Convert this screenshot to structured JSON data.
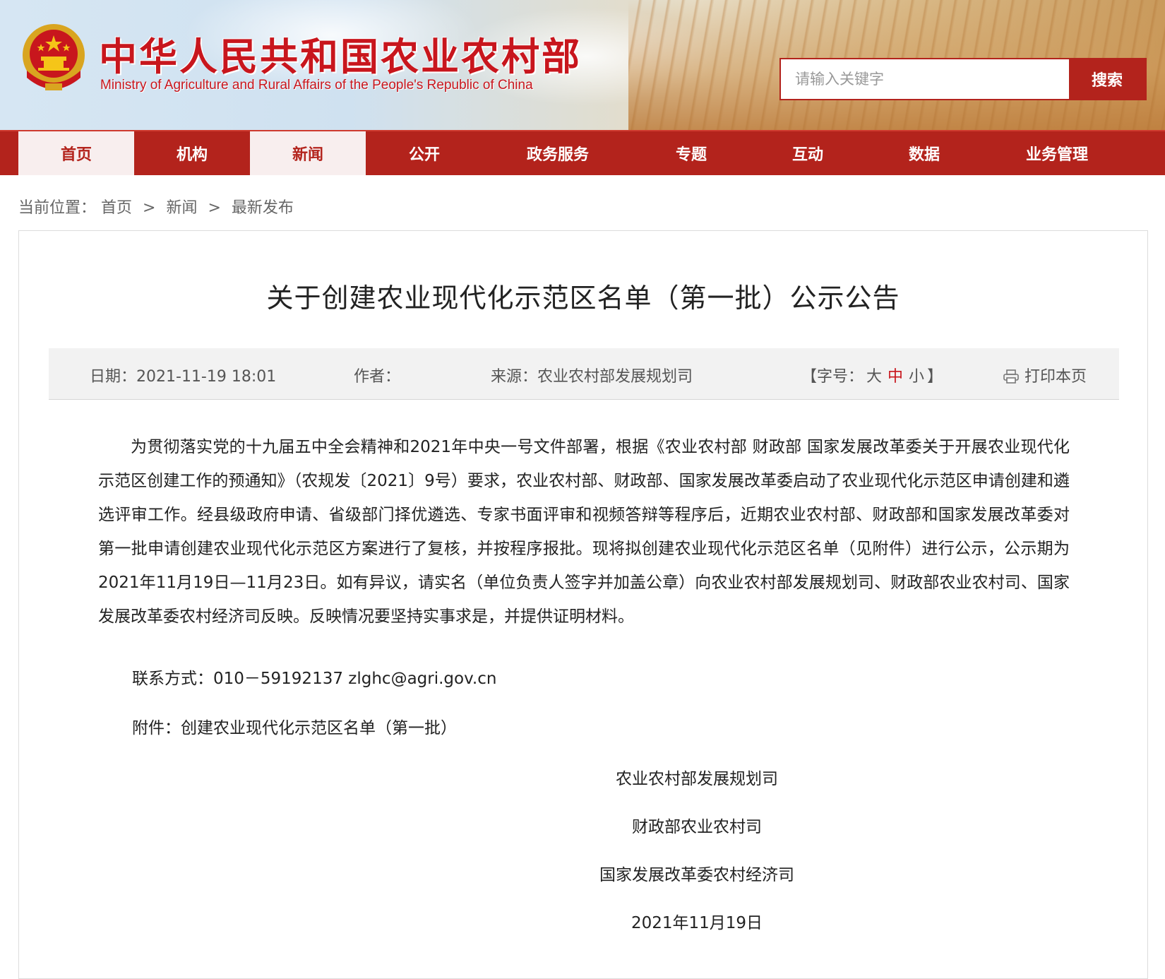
{
  "header": {
    "site_title": "中华人民共和国农业农村部",
    "site_subtitle": "Ministry of Agriculture and Rural Affairs of the People's Republic of China",
    "emblem_icon": "national-emblem-icon",
    "search": {
      "placeholder": "请输入关键字",
      "button_label": "搜索"
    }
  },
  "nav": {
    "items": [
      {
        "label": "首页",
        "active": true
      },
      {
        "label": "机构",
        "active": false
      },
      {
        "label": "新闻",
        "active": true
      },
      {
        "label": "公开",
        "active": false
      },
      {
        "label": "政务服务",
        "active": false
      },
      {
        "label": "专题",
        "active": false
      },
      {
        "label": "互动",
        "active": false
      },
      {
        "label": "数据",
        "active": false
      },
      {
        "label": "业务管理",
        "active": false
      }
    ]
  },
  "breadcrumb": {
    "prefix": "当前位置：",
    "items": [
      "首页",
      "新闻",
      "最新发布"
    ],
    "separator": ">"
  },
  "article": {
    "title": "关于创建农业现代化示范区名单（第一批）公示公告",
    "meta": {
      "date_label": "日期：",
      "date_value": "2021-11-19 18:01",
      "author_label": "作者：",
      "author_value": "",
      "source_label": "来源：",
      "source_value": "农业农村部发展规划司",
      "fontsize_open": "【字号：",
      "fontsize_large": "大",
      "fontsize_medium": "中",
      "fontsize_small": "小",
      "fontsize_close": "】",
      "print_label": "打印本页",
      "print_icon": "printer-icon"
    },
    "body": "为贯彻落实党的十九届五中全会精神和2021年中央一号文件部署，根据《农业农村部 财政部 国家发展改革委关于开展农业现代化示范区创建工作的预通知》（农规发〔2021〕9号）要求，农业农村部、财政部、国家发展改革委启动了农业现代化示范区申请创建和遴选评审工作。经县级政府申请、省级部门择优遴选、专家书面评审和视频答辩等程序后，近期农业农村部、财政部和国家发展改革委对第一批申请创建农业现代化示范区方案进行了复核，并按程序报批。现将拟创建农业现代化示范区名单（见附件）进行公示，公示期为2021年11月19日—11月23日。如有异议，请实名（单位负责人签字并加盖公章）向农业农村部发展规划司、财政部农业农村司、国家发展改革委农村经济司反映。反映情况要坚持实事求是，并提供证明材料。",
    "contact": "联系方式：010－59192137 zlghc@agri.gov.cn",
    "attachment_label": "附件：",
    "attachment_link": "创建农业现代化示范区名单（第一批）",
    "signatures": [
      "农业农村部发展规划司",
      "财政部农业农村司",
      "国家发展改革委农村经济司"
    ],
    "sign_date": "2021年11月19日"
  },
  "colors": {
    "brand_red": "#b3231c",
    "title_red": "#c8161d",
    "meta_bg": "#f2f2f2"
  }
}
